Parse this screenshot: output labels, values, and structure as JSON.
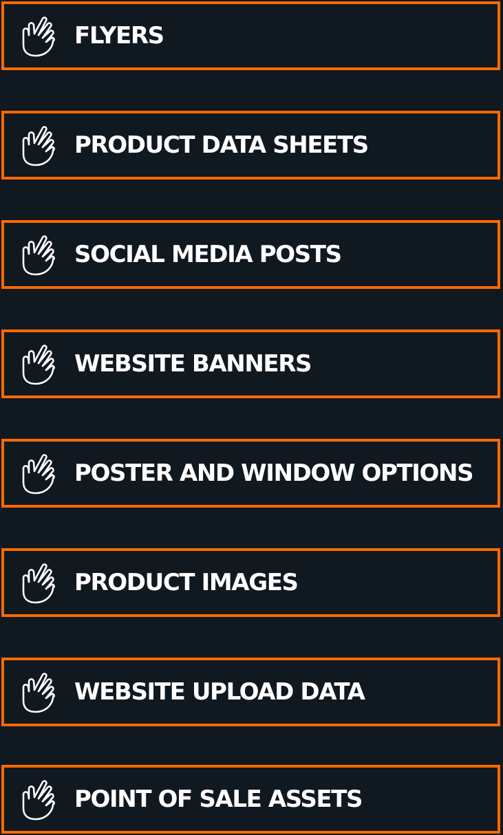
{
  "theme": {
    "background": "#101820",
    "accent": "#ff6a00",
    "text": "#ffffff"
  },
  "items": [
    {
      "label": "FLYERS",
      "icon": "pointing-hand-icon"
    },
    {
      "label": "PRODUCT DATA SHEETS",
      "icon": "pointing-hand-icon"
    },
    {
      "label": "SOCIAL MEDIA POSTS",
      "icon": "pointing-hand-icon"
    },
    {
      "label": "WEBSITE BANNERS",
      "icon": "pointing-hand-icon"
    },
    {
      "label": "POSTER AND WINDOW OPTIONS",
      "icon": "pointing-hand-icon"
    },
    {
      "label": "PRODUCT IMAGES",
      "icon": "pointing-hand-icon"
    },
    {
      "label": "WEBSITE UPLOAD DATA",
      "icon": "pointing-hand-icon"
    },
    {
      "label": "POINT OF SALE ASSETS",
      "icon": "pointing-hand-icon"
    }
  ]
}
